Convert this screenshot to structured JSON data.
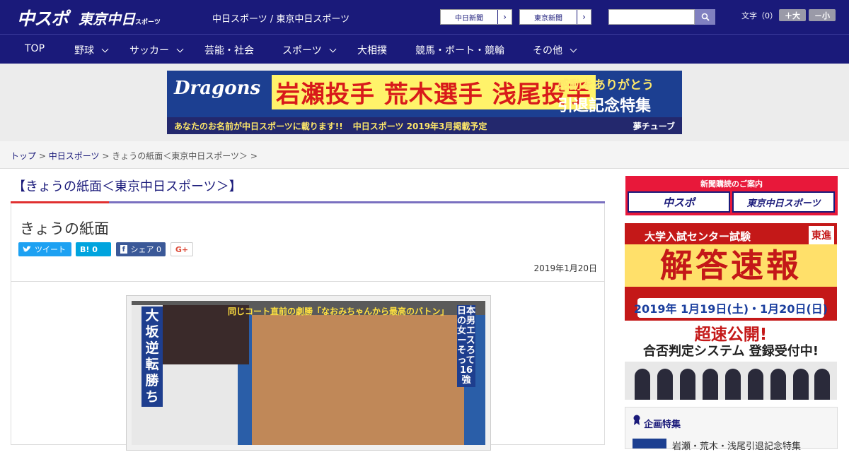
{
  "header": {
    "logo_chuspo": "中スポ",
    "logo_tokyo": "東京中日",
    "logo_tokyo_small": "スポーツ",
    "site_title": "中日スポーツ / 東京中日スポーツ",
    "newspaper_links": [
      "中日新聞",
      "東京新聞"
    ],
    "search_placeholder": "",
    "font_size_label": "文字（0）",
    "font_bigger": "＋大",
    "font_smaller": "－小"
  },
  "nav": {
    "items": [
      {
        "label": "TOP",
        "dropdown": false
      },
      {
        "label": "野球",
        "dropdown": true
      },
      {
        "label": "サッカー",
        "dropdown": true
      },
      {
        "label": "芸能・社会",
        "dropdown": false
      },
      {
        "label": "スポーツ",
        "dropdown": true
      },
      {
        "label": "大相撲",
        "dropdown": false
      },
      {
        "label": "競馬・ボート・競輪",
        "dropdown": false
      },
      {
        "label": "その他",
        "dropdown": true
      }
    ]
  },
  "ad_banner": {
    "brand": "Dragons",
    "main": "岩瀬投手 荒木選手 浅尾投手",
    "sub1": "感動をありがとう",
    "sub2": "引退記念特集",
    "footer_left": "あなたのお名前が中日スポーツに載ります!!",
    "footer_mid": "中日スポーツ 2019年3月掲載予定",
    "footer_right": "夢チューブ"
  },
  "breadcrumb": {
    "items": [
      "トップ",
      "中日スポーツ",
      "きょうの紙面＜東京中日スポーツ＞"
    ],
    "separator": ">"
  },
  "page": {
    "heading": "【きょうの紙面＜東京中日スポーツ＞】",
    "article_title": "きょうの紙面",
    "date": "2019年1月20日"
  },
  "share": {
    "tweet": "ツイート",
    "hatena": "B! 0",
    "facebook": "シェア 0",
    "gplus": "G+"
  },
  "paper": {
    "headline_left": "大坂逆転勝ち",
    "headline_top": "同じコート直前の劇勝「なおみちゃんから最高のバトン」",
    "headline_right": "日本の男女エースそろって16強"
  },
  "sidebar": {
    "subscription_title": "新聞購読のご案内",
    "sub_logos": [
      "中スポ",
      "東京中日スポーツ"
    ],
    "toshin_top": "大学入試センター試験",
    "toshin_logo": "東進",
    "toshin_main": "解答速報",
    "toshin_date": "2019年 1月19日(土)・1月20日(日)",
    "toshin_fast": "超速公開!",
    "toshin_system": "合否判定システム 登録受付中!",
    "feature_title": "企画特集",
    "feature_item": "岩瀬・荒木・浅尾引退記念特集"
  },
  "colors": {
    "brand_navy": "#1a1a7a",
    "accent_red": "#e03030",
    "twitter": "#1da1f2",
    "hatena": "#00a4de",
    "facebook": "#3b5998"
  }
}
